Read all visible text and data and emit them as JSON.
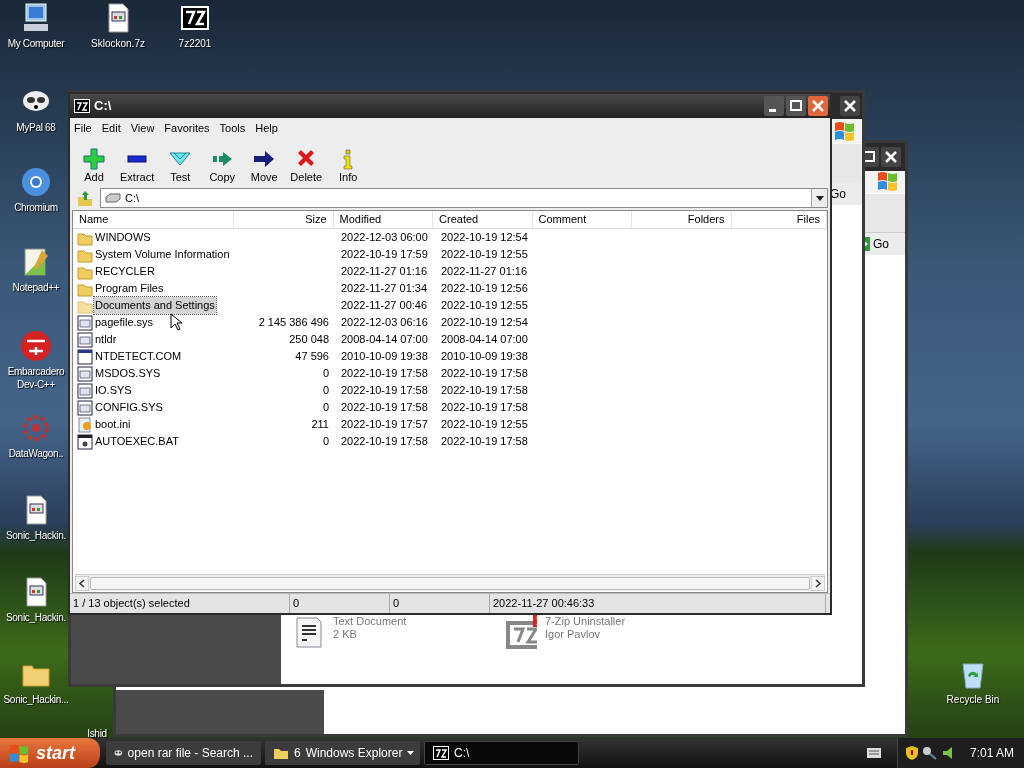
{
  "desktop_icons": [
    {
      "label": "My Computer",
      "kind": "computer"
    },
    {
      "label": "Sklockon.7z",
      "kind": "document"
    },
    {
      "label": "7z2201",
      "kind": "sevenzip"
    },
    {
      "label": "MyPal 68",
      "kind": "raccoon"
    },
    {
      "label": "Chromium",
      "kind": "browser"
    },
    {
      "label": "Notepad++",
      "kind": "notepad"
    },
    {
      "label": "Embarcadero Dev-C++",
      "kind": "dev"
    },
    {
      "label": "DataWagon..",
      "kind": "wagon"
    },
    {
      "label": "Sonic_Hackin.",
      "kind": "document"
    },
    {
      "label": "Sonic_Hackin.",
      "kind": "document"
    },
    {
      "label": "Sonic_Hackin...",
      "kind": "folder"
    },
    {
      "label": "Ishid",
      "kind": "none"
    },
    {
      "label": "Recycle Bin",
      "kind": "recycle"
    }
  ],
  "background_windows": [
    {
      "go": "Go"
    },
    {
      "go": "Go",
      "items": [
        {
          "name": "Text Document",
          "detail": "2 KB",
          "kind": "text"
        },
        {
          "name": "7-Zip Uninstaller",
          "detail": "Igor Pavlov",
          "kind": "uninstaller"
        }
      ]
    }
  ],
  "window": {
    "title": "C:\\",
    "menu": [
      "File",
      "Edit",
      "View",
      "Favorites",
      "Tools",
      "Help"
    ],
    "toolbar": [
      {
        "label": "Add",
        "kind": "add"
      },
      {
        "label": "Extract",
        "kind": "extract"
      },
      {
        "label": "Test",
        "kind": "test"
      },
      {
        "label": "Copy",
        "kind": "copy"
      },
      {
        "label": "Move",
        "kind": "move"
      },
      {
        "label": "Delete",
        "kind": "delete"
      },
      {
        "label": "Info",
        "kind": "info"
      }
    ],
    "address": "C:\\",
    "columns": [
      "Name",
      "Size",
      "Modified",
      "Created",
      "Comment",
      "Folders",
      "Files"
    ],
    "rows": [
      {
        "name": "WINDOWS",
        "size": "",
        "modified": "2022-12-03 06:00",
        "created": "2022-10-19 12:54",
        "kind": "folder",
        "selected": false
      },
      {
        "name": "System Volume Information",
        "size": "",
        "modified": "2022-10-19 17:59",
        "created": "2022-10-19 12:55",
        "kind": "folder",
        "selected": false
      },
      {
        "name": "RECYCLER",
        "size": "",
        "modified": "2022-11-27 01:16",
        "created": "2022-11-27 01:16",
        "kind": "folder",
        "selected": false
      },
      {
        "name": "Program Files",
        "size": "",
        "modified": "2022-11-27 01:34",
        "created": "2022-10-19 12:56",
        "kind": "folder",
        "selected": false
      },
      {
        "name": "Documents and Settings",
        "size": "",
        "modified": "2022-11-27 00:46",
        "created": "2022-10-19 12:55",
        "kind": "folder",
        "selected": true
      },
      {
        "name": "pagefile.sys",
        "size": "2 145 386 496",
        "modified": "2022-12-03 06:16",
        "created": "2022-10-19 12:54",
        "kind": "system",
        "selected": false
      },
      {
        "name": "ntldr",
        "size": "250 048",
        "modified": "2008-04-14 07:00",
        "created": "2008-04-14 07:00",
        "kind": "system",
        "selected": false
      },
      {
        "name": "NTDETECT.COM",
        "size": "47 596",
        "modified": "2010-10-09 19:38",
        "created": "2010-10-09 19:38",
        "kind": "program",
        "selected": false
      },
      {
        "name": "MSDOS.SYS",
        "size": "0",
        "modified": "2022-10-19 17:58",
        "created": "2022-10-19 17:58",
        "kind": "system",
        "selected": false
      },
      {
        "name": "IO.SYS",
        "size": "0",
        "modified": "2022-10-19 17:58",
        "created": "2022-10-19 17:58",
        "kind": "system",
        "selected": false
      },
      {
        "name": "CONFIG.SYS",
        "size": "0",
        "modified": "2022-10-19 17:58",
        "created": "2022-10-19 17:58",
        "kind": "system",
        "selected": false
      },
      {
        "name": "boot.ini",
        "size": "211",
        "modified": "2022-10-19 17:57",
        "created": "2022-10-19 12:55",
        "kind": "settings",
        "selected": false
      },
      {
        "name": "AUTOEXEC.BAT",
        "size": "0",
        "modified": "2022-10-19 17:58",
        "created": "2022-10-19 17:58",
        "kind": "batch",
        "selected": false
      }
    ],
    "status": [
      "1 / 13 object(s) selected",
      "0",
      "0",
      "2022-11-27 00:46:33"
    ]
  },
  "taskbar": {
    "start": "start",
    "tasks": [
      {
        "label": "open rar file - Search ...",
        "kind": "search",
        "selected": false
      },
      {
        "label": "Windows Explorer",
        "count": "6",
        "kind": "group",
        "selected": false
      },
      {
        "label": "C:\\",
        "kind": "sevenzip",
        "selected": true
      }
    ],
    "clock": "7:01 AM"
  }
}
